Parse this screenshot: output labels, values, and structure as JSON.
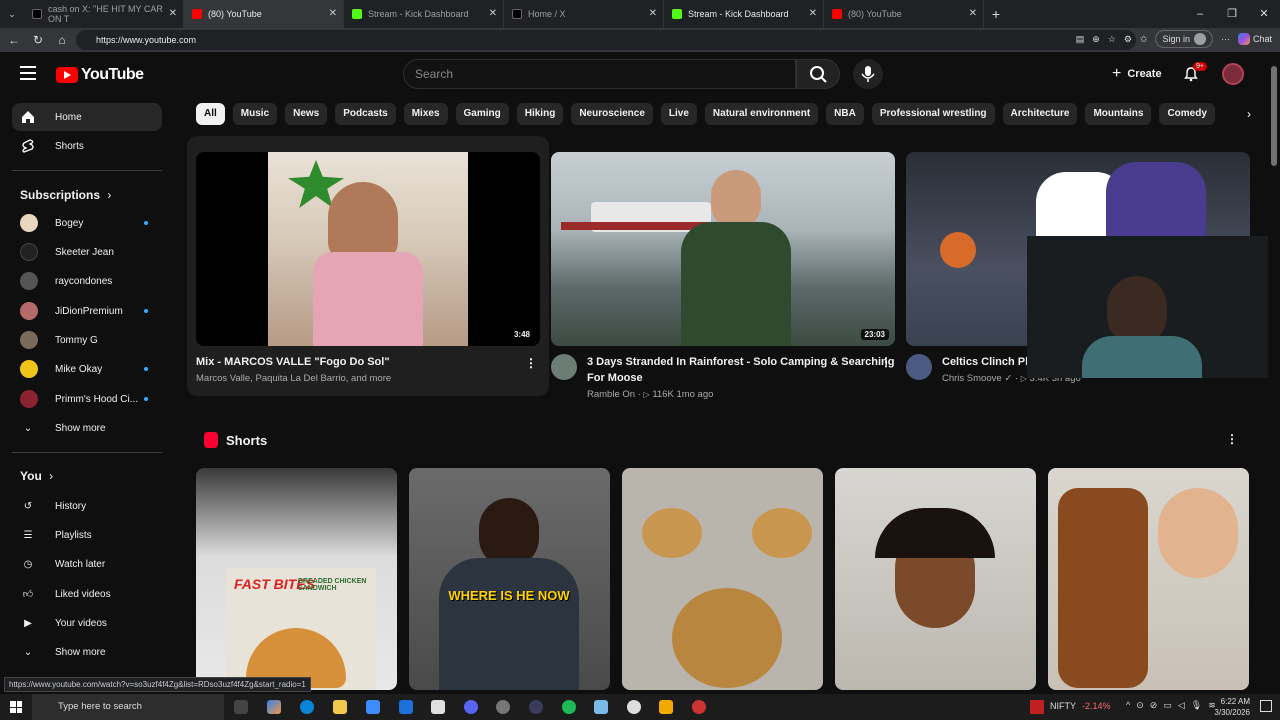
{
  "browser": {
    "tabs": [
      {
        "label": "cash on X: \"HE HIT MY CAR ON T",
        "color": "#000000"
      },
      {
        "label": "(80) YouTube",
        "color": "#ff0000"
      },
      {
        "label": "Stream - Kick Dashboard",
        "color": "#53fc18"
      },
      {
        "label": "Home / X",
        "color": "#000000"
      },
      {
        "label": "Stream - Kick Dashboard",
        "color": "#53fc18"
      },
      {
        "label": "(80) YouTube",
        "color": "#ff0000"
      }
    ],
    "url": "https://www.youtube.com",
    "signin_label": "Sign in",
    "chat_label": "Chat"
  },
  "header": {
    "logo_text": "YouTube",
    "search_placeholder": "Search",
    "create_label": "Create",
    "notifications_badge": "9+"
  },
  "sidebar": {
    "home": "Home",
    "shorts": "Shorts",
    "subscriptions_title": "Subscriptions",
    "subscriptions": [
      {
        "name": "Bogey",
        "color": "#e8d6c3",
        "new": true
      },
      {
        "name": "Skeeter Jean",
        "color": "#222222",
        "new": false
      },
      {
        "name": "raycondones",
        "color": "#555555",
        "new": false
      },
      {
        "name": "JiDionPremium",
        "color": "#b46a6a",
        "new": true
      },
      {
        "name": "Tommy G",
        "color": "#7a6a5c",
        "new": false
      },
      {
        "name": "Mike Okay",
        "color": "#f0c419",
        "new": true
      },
      {
        "name": "Primm's Hood Ci...",
        "color": "#8b2230",
        "new": true
      }
    ],
    "show_more": "Show more",
    "you_title": "You",
    "you_items": [
      "History",
      "Playlists",
      "Watch later",
      "Liked videos",
      "Your videos"
    ],
    "show_more_2": "Show more"
  },
  "chips": [
    "All",
    "Music",
    "News",
    "Podcasts",
    "Mixes",
    "Gaming",
    "Hiking",
    "Neuroscience",
    "Live",
    "Natural environment",
    "NBA",
    "Professional wrestling",
    "Architecture",
    "Mountains",
    "Comedy"
  ],
  "videos": [
    {
      "title": "Mix - MARCOS VALLE \"Fogo Do Sol\"",
      "meta": "Marcos Valle, Paquita La Del Barrio, and more",
      "duration": "3:48"
    },
    {
      "title": "3 Days Stranded In Rainforest - Solo Camping & Searching For Moose",
      "channel": "Ramble On",
      "views": "116K",
      "age": "1mo ago",
      "duration": "23:03"
    },
    {
      "title": "Celtics Clinch Pl... Hornets!",
      "channel": "Chris Smoove",
      "views": "3.4K",
      "age": "3h ago"
    }
  ],
  "shorts_section": {
    "title": "Shorts",
    "overlay_texts": [
      "WHERE IS HE NOW",
      "FAST BITES",
      "BREADED CHICKEN SANDWICH"
    ]
  },
  "status_url": "https://www.youtube.com/watch?v=so3uzf4f4Zg&list=RDso3uzf4f4Zg&start_radio=1",
  "taskbar": {
    "search_placeholder": "Type here to search",
    "ticker_name": "NIFTY",
    "ticker_change": "-2.14%",
    "time": "6:22 AM",
    "date": "3/30/2026"
  }
}
